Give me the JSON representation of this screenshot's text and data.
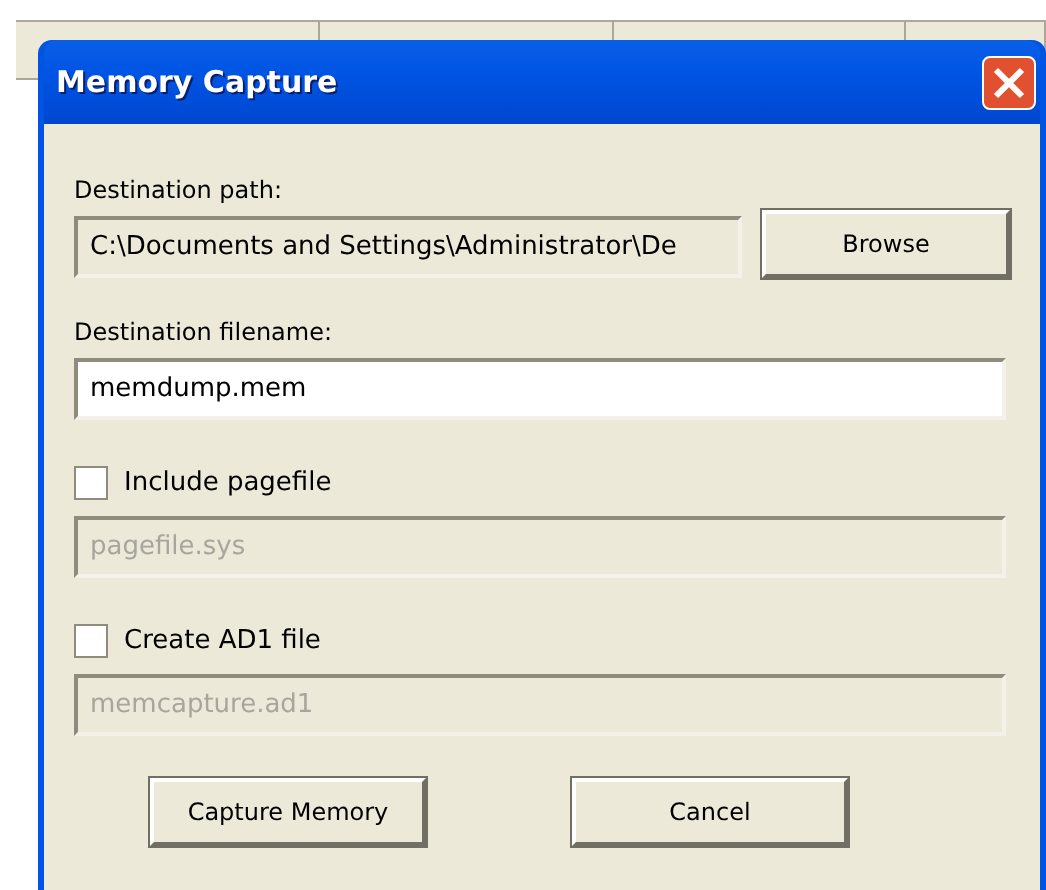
{
  "window": {
    "title": "Memory Capture"
  },
  "destination_path": {
    "label": "Destination path:",
    "value": "C:\\Documents and Settings\\Administrator\\De",
    "disabled": true,
    "button": "Browse"
  },
  "destination_filename": {
    "label": "Destination filename:",
    "value": "memdump.mem",
    "disabled": false
  },
  "options": [
    {
      "label": "Include pagefile",
      "checked": false,
      "value": "pagefile.sys"
    },
    {
      "label": "Create AD1 file",
      "checked": false,
      "value": "memcapture.ad1"
    }
  ],
  "buttons": [
    "Capture Memory",
    "Cancel"
  ]
}
